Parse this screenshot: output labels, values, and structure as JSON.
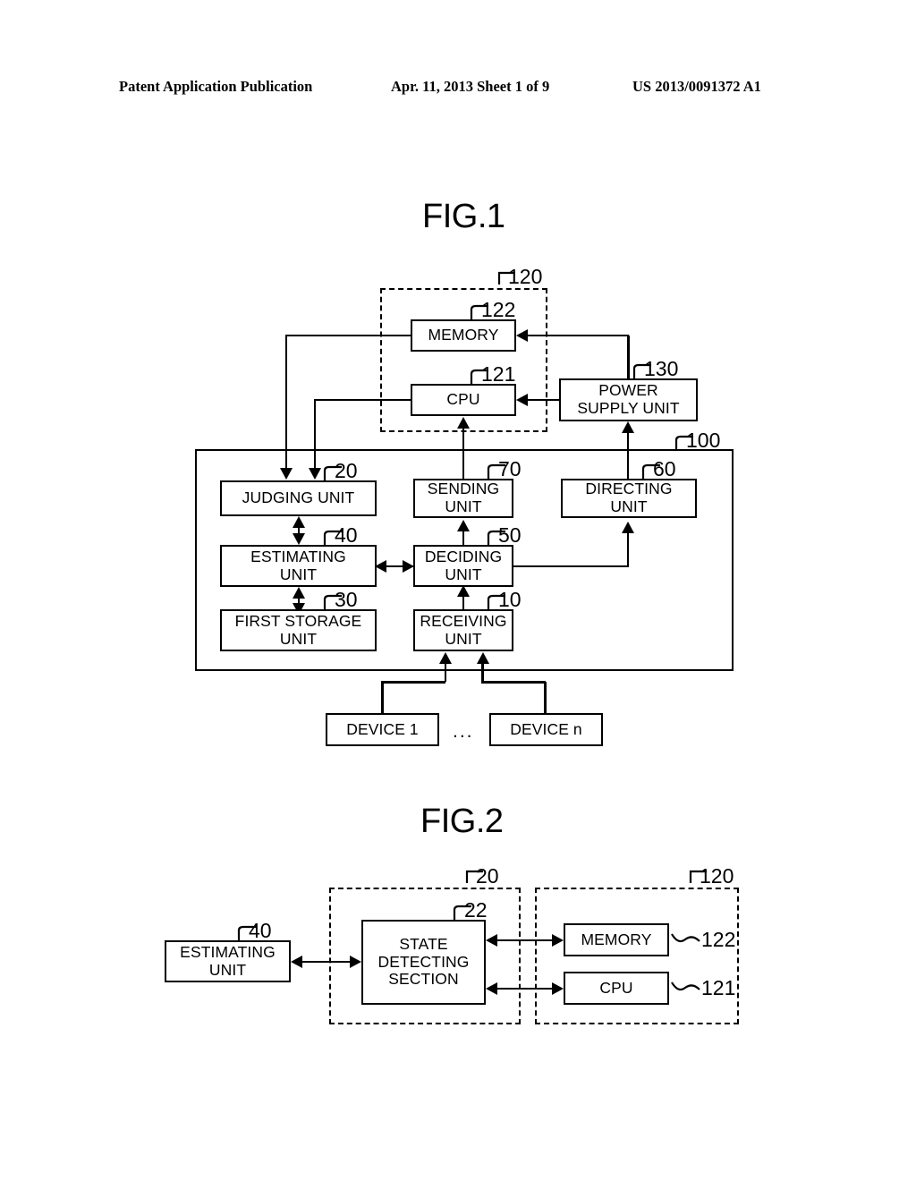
{
  "header": {
    "left": "Patent Application Publication",
    "middle": "Apr. 11, 2013  Sheet 1 of 9",
    "right": "US 2013/0091372 A1"
  },
  "figures": [
    {
      "title": "FIG.1",
      "container_labels": [
        {
          "ref": "120",
          "kind": "dashed"
        },
        {
          "ref": "100",
          "kind": "solid"
        }
      ],
      "blocks": [
        {
          "ref": "122",
          "lines": [
            "MEMORY"
          ]
        },
        {
          "ref": "121",
          "lines": [
            "CPU"
          ]
        },
        {
          "ref": "130",
          "lines": [
            "POWER",
            "SUPPLY UNIT"
          ]
        },
        {
          "ref": "20",
          "lines": [
            "JUDGING UNIT"
          ]
        },
        {
          "ref": "70",
          "lines": [
            "SENDING",
            "UNIT"
          ]
        },
        {
          "ref": "60",
          "lines": [
            "DIRECTING",
            "UNIT"
          ]
        },
        {
          "ref": "40",
          "lines": [
            "ESTIMATING",
            "UNIT"
          ]
        },
        {
          "ref": "50",
          "lines": [
            "DECIDING",
            "UNIT"
          ]
        },
        {
          "ref": "30",
          "lines": [
            "FIRST STORAGE",
            "UNIT"
          ]
        },
        {
          "ref": "10",
          "lines": [
            "RECEIVING",
            "UNIT"
          ]
        },
        {
          "ref": "",
          "lines": [
            "DEVICE 1"
          ]
        },
        {
          "ref": "",
          "lines": [
            "DEVICE n"
          ]
        }
      ],
      "ellipsis": "..."
    },
    {
      "title": "FIG.2",
      "container_labels": [
        {
          "ref": "20",
          "kind": "dashed"
        },
        {
          "ref": "120",
          "kind": "dashed"
        }
      ],
      "blocks": [
        {
          "ref": "40",
          "lines": [
            "ESTIMATING",
            "UNIT"
          ]
        },
        {
          "ref": "22",
          "lines": [
            "STATE",
            "DETECTING",
            "SECTION"
          ]
        },
        {
          "ref": "122",
          "lines": [
            "MEMORY"
          ]
        },
        {
          "ref": "121",
          "lines": [
            "CPU"
          ]
        }
      ]
    }
  ],
  "colors": {
    "ink": "#000000",
    "paper": "#ffffff"
  }
}
